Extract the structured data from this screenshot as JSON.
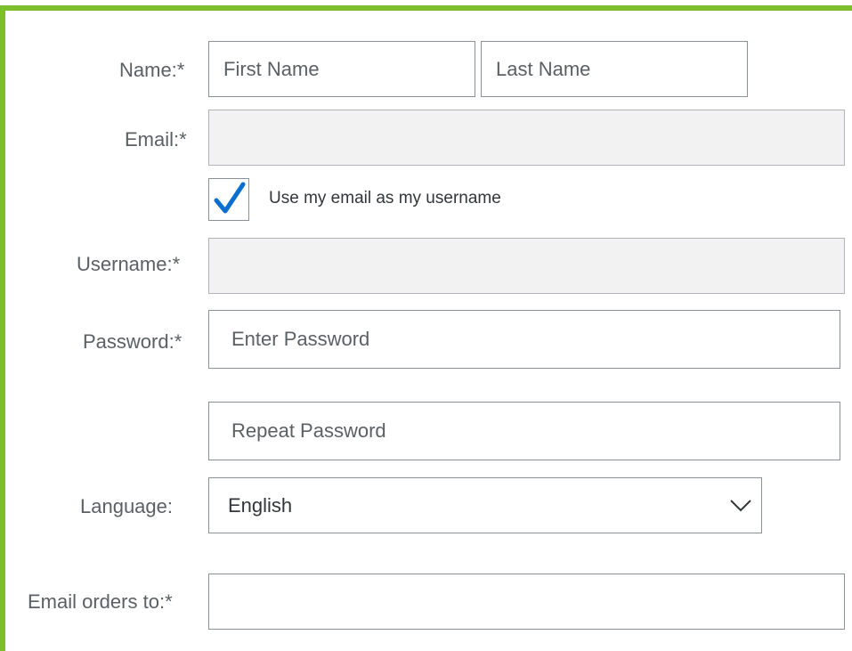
{
  "form": {
    "name_label": "Name:",
    "email_label": "Email:",
    "username_label": "Username:",
    "password_label": "Password:",
    "language_label": "Language:",
    "email_orders_label": "Email orders to:",
    "required_marker": "*",
    "first_name": {
      "value": "",
      "placeholder": "First Name"
    },
    "last_name": {
      "value": "",
      "placeholder": "Last Name"
    },
    "email": {
      "value": "",
      "placeholder": ""
    },
    "use_email_as_username": {
      "checked": true,
      "label": "Use my email as my username"
    },
    "username": {
      "value": "",
      "placeholder": ""
    },
    "password": {
      "value": "",
      "placeholder": "Enter Password"
    },
    "repeat_password": {
      "value": "",
      "placeholder": "Repeat Password"
    },
    "language": {
      "selected": "English"
    },
    "email_orders_to": {
      "value": "",
      "placeholder": ""
    }
  },
  "colors": {
    "frame_border": "#7cbf2a",
    "checkmark": "#0a6ed1",
    "readonly_bg": "#f2f2f2"
  },
  "icons": {
    "checkmark": "checkmark-icon",
    "dropdown": "chevron-down-icon"
  }
}
